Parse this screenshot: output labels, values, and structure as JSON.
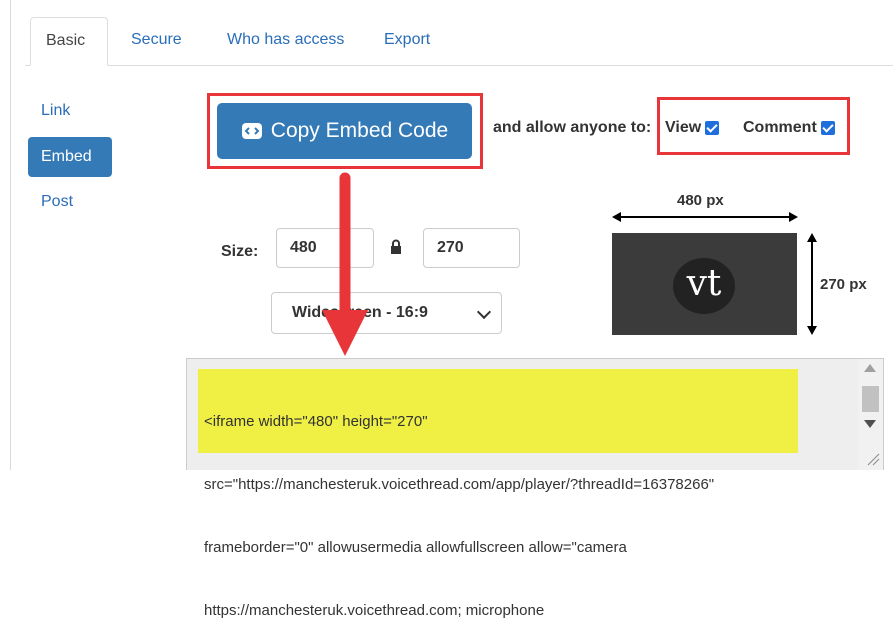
{
  "tabs": [
    {
      "label": "Basic",
      "active": true
    },
    {
      "label": "Secure",
      "active": false
    },
    {
      "label": "Who has access",
      "active": false
    },
    {
      "label": "Export",
      "active": false
    }
  ],
  "side_nav": [
    {
      "label": "Link",
      "active": false
    },
    {
      "label": "Embed",
      "active": true
    },
    {
      "label": "Post",
      "active": false
    }
  ],
  "copy_button": {
    "label": "Copy Embed Code",
    "icon": "embed-icon"
  },
  "allow_text": "and allow anyone to:",
  "permissions": [
    {
      "label": "View",
      "checked": true
    },
    {
      "label": "Comment",
      "checked": true
    }
  ],
  "size": {
    "label": "Size:",
    "width": "480",
    "height": "270",
    "lock_icon": "lock-icon"
  },
  "aspect_select": {
    "value": "Widescreen - 16:9"
  },
  "preview": {
    "width_label": "480 px",
    "height_label": "270 px",
    "logo_text": "vt"
  },
  "embed_code": {
    "lines": [
      "<iframe width=\"480\" height=\"270\"",
      "src=\"https://manchesteruk.voicethread.com/app/player/?threadId=16378266\"",
      "frameborder=\"0\" allowusermedia allowfullscreen allow=\"camera",
      "https://manchesteruk.voicethread.com; microphone"
    ]
  },
  "colors": {
    "primary": "#337ab7",
    "link": "#2a6db8",
    "annotation_red": "#e8353a",
    "highlight_yellow": "#efef44",
    "checkbox_blue": "#1e6fdc"
  }
}
